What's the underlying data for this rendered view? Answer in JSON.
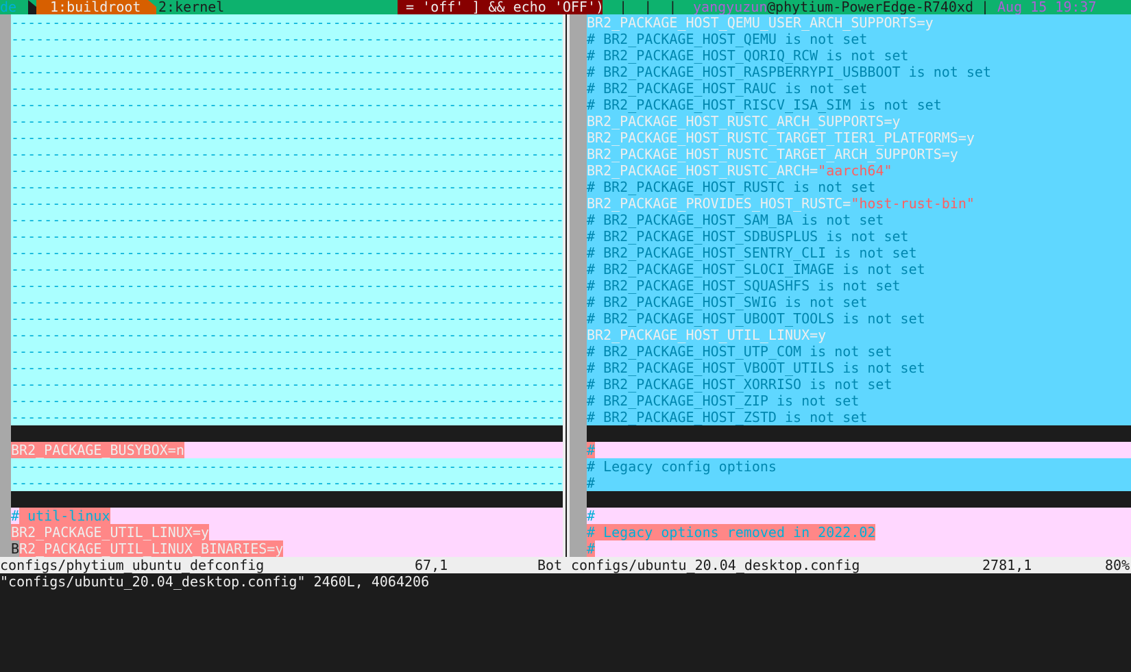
{
  "tmux": {
    "session": "de",
    "windows": [
      {
        "label": "1:buildroot",
        "active": true
      },
      {
        "label": "2:kernel",
        "active": false
      }
    ],
    "command_fragment": " = 'off' ] && echo 'OFF')",
    "separators": "  |  |  |  ",
    "user": "yangyuzun",
    "host": "@phytium-PowerEdge-R740xd",
    "divider": " | ",
    "datetime": "Aug 15 19:37"
  },
  "colors": {
    "tmux_bg": "#0db26e",
    "active_window": "#d75f00",
    "cmd_bg": "#870000",
    "accent_purple": "#af5fd7",
    "diff_change": "#5fd7ff",
    "diff_add": "#ffd7ff",
    "diff_text": "#ff8787",
    "filler": "#aaffff"
  },
  "filler_char": "-",
  "left": {
    "lines": [
      {
        "bg": "filler"
      },
      {
        "bg": "filler"
      },
      {
        "bg": "filler"
      },
      {
        "bg": "filler"
      },
      {
        "bg": "filler"
      },
      {
        "bg": "filler"
      },
      {
        "bg": "filler"
      },
      {
        "bg": "filler"
      },
      {
        "bg": "filler"
      },
      {
        "bg": "filler"
      },
      {
        "bg": "filler"
      },
      {
        "bg": "filler"
      },
      {
        "bg": "filler"
      },
      {
        "bg": "filler"
      },
      {
        "bg": "filler"
      },
      {
        "bg": "filler"
      },
      {
        "bg": "filler"
      },
      {
        "bg": "filler"
      },
      {
        "bg": "filler"
      },
      {
        "bg": "filler"
      },
      {
        "bg": "filler"
      },
      {
        "bg": "filler"
      },
      {
        "bg": "filler"
      },
      {
        "bg": "filler"
      },
      {
        "bg": "filler"
      },
      {
        "bg": "blank"
      },
      {
        "bg": "pink",
        "segs": [
          {
            "t": "BR2_PACKAGE_BUSYBOX=n",
            "c": "hl"
          }
        ]
      },
      {
        "bg": "filler"
      },
      {
        "bg": "filler"
      },
      {
        "bg": "blank"
      },
      {
        "bg": "pink",
        "segs": [
          {
            "t": "#",
            "c": "cmtl"
          },
          {
            "t": " util-linux",
            "c": "hlc"
          }
        ]
      },
      {
        "bg": "pink",
        "segs": [
          {
            "t": "BR2_PACKAGE_UTIL_LINUX=y",
            "c": "hl"
          }
        ]
      },
      {
        "bg": "pink",
        "segs": [
          {
            "t": "B",
            "c": "cur"
          },
          {
            "t": "R2_PACKAGE_UTIL_LINUX_BINARIES=y",
            "c": "hl"
          }
        ]
      }
    ]
  },
  "right": {
    "lines": [
      {
        "bg": "blue",
        "segs": [
          {
            "t": "BR2_PACKAGE_HOST_QEMU_USER_ARCH_SUPPORTS=y",
            "c": "set"
          }
        ]
      },
      {
        "bg": "blue",
        "segs": [
          {
            "t": "# BR2_PACKAGE_HOST_QEMU is not set",
            "c": "cmt"
          }
        ]
      },
      {
        "bg": "blue",
        "segs": [
          {
            "t": "# BR2_PACKAGE_HOST_QORIQ_RCW is not set",
            "c": "cmt"
          }
        ]
      },
      {
        "bg": "blue",
        "segs": [
          {
            "t": "# BR2_PACKAGE_HOST_RASPBERRYPI_USBBOOT is not set",
            "c": "cmt"
          }
        ]
      },
      {
        "bg": "blue",
        "segs": [
          {
            "t": "# BR2_PACKAGE_HOST_RAUC is not set",
            "c": "cmt"
          }
        ]
      },
      {
        "bg": "blue",
        "segs": [
          {
            "t": "# BR2_PACKAGE_HOST_RISCV_ISA_SIM is not set",
            "c": "cmt"
          }
        ]
      },
      {
        "bg": "blue",
        "segs": [
          {
            "t": "BR2_PACKAGE_HOST_RUSTC_ARCH_SUPPORTS=y",
            "c": "set"
          }
        ]
      },
      {
        "bg": "blue",
        "segs": [
          {
            "t": "BR2_PACKAGE_HOST_RUSTC_TARGET_TIER1_PLATFORMS=y",
            "c": "set"
          }
        ]
      },
      {
        "bg": "blue",
        "segs": [
          {
            "t": "BR2_PACKAGE_HOST_RUSTC_TARGET_ARCH_SUPPORTS=y",
            "c": "set"
          }
        ]
      },
      {
        "bg": "blue",
        "segs": [
          {
            "t": "BR2_PACKAGE_HOST_RUSTC_ARCH=",
            "c": "set"
          },
          {
            "t": "\"aarch64\"",
            "c": "str"
          }
        ]
      },
      {
        "bg": "blue",
        "segs": [
          {
            "t": "# BR2_PACKAGE_HOST_RUSTC is not set",
            "c": "cmt"
          }
        ]
      },
      {
        "bg": "blue",
        "segs": [
          {
            "t": "BR2_PACKAGE_PROVIDES_HOST_RUSTC=",
            "c": "set"
          },
          {
            "t": "\"host-rust-bin\"",
            "c": "str"
          }
        ]
      },
      {
        "bg": "blue",
        "segs": [
          {
            "t": "# BR2_PACKAGE_HOST_SAM_BA is not set",
            "c": "cmt"
          }
        ]
      },
      {
        "bg": "blue",
        "segs": [
          {
            "t": "# BR2_PACKAGE_HOST_SDBUSPLUS is not set",
            "c": "cmt"
          }
        ]
      },
      {
        "bg": "blue",
        "segs": [
          {
            "t": "# BR2_PACKAGE_HOST_SENTRY_CLI is not set",
            "c": "cmt"
          }
        ]
      },
      {
        "bg": "blue",
        "segs": [
          {
            "t": "# BR2_PACKAGE_HOST_SLOCI_IMAGE is not set",
            "c": "cmt"
          }
        ]
      },
      {
        "bg": "blue",
        "segs": [
          {
            "t": "# BR2_PACKAGE_HOST_SQUASHFS is not set",
            "c": "cmt"
          }
        ]
      },
      {
        "bg": "blue",
        "segs": [
          {
            "t": "# BR2_PACKAGE_HOST_SWIG is not set",
            "c": "cmt"
          }
        ]
      },
      {
        "bg": "blue",
        "segs": [
          {
            "t": "# BR2_PACKAGE_HOST_UBOOT_TOOLS is not set",
            "c": "cmt"
          }
        ]
      },
      {
        "bg": "blue",
        "segs": [
          {
            "t": "BR2_PACKAGE_HOST_UTIL_LINUX=y",
            "c": "set"
          }
        ]
      },
      {
        "bg": "blue",
        "segs": [
          {
            "t": "# BR2_PACKAGE_HOST_UTP_COM is not set",
            "c": "cmt"
          }
        ]
      },
      {
        "bg": "blue",
        "segs": [
          {
            "t": "# BR2_PACKAGE_HOST_VBOOT_UTILS is not set",
            "c": "cmt"
          }
        ]
      },
      {
        "bg": "blue",
        "segs": [
          {
            "t": "# BR2_PACKAGE_HOST_XORRISO is not set",
            "c": "cmt"
          }
        ]
      },
      {
        "bg": "blue",
        "segs": [
          {
            "t": "# BR2_PACKAGE_HOST_ZIP is not set",
            "c": "cmt"
          }
        ]
      },
      {
        "bg": "blue",
        "segs": [
          {
            "t": "# BR2_PACKAGE_HOST_ZSTD is not set",
            "c": "cmt"
          }
        ]
      },
      {
        "bg": "blank"
      },
      {
        "bg": "pink",
        "segs": [
          {
            "t": "#",
            "c": "hlc"
          }
        ]
      },
      {
        "bg": "blue",
        "segs": [
          {
            "t": "# Legacy config options",
            "c": "cmt"
          }
        ]
      },
      {
        "bg": "blue",
        "segs": [
          {
            "t": "#",
            "c": "cmt"
          }
        ]
      },
      {
        "bg": "blank"
      },
      {
        "bg": "pink",
        "segs": [
          {
            "t": "#",
            "c": "cmtl"
          }
        ]
      },
      {
        "bg": "pink",
        "segs": [
          {
            "t": "# Legacy options removed in 2022.02",
            "c": "hlc"
          }
        ]
      },
      {
        "bg": "pink",
        "segs": [
          {
            "t": "#",
            "c": "hlc"
          }
        ]
      }
    ]
  },
  "status": {
    "left_file": "configs/phytium_ubuntu_defconfig",
    "left_pos": "67,1",
    "left_scroll": "Bot",
    "right_file": "configs/ubuntu_20.04_desktop.config",
    "right_pos": "2781,1",
    "right_scroll": "80%"
  },
  "message": "\"configs/ubuntu_20.04_desktop.config\" 2460L, 4064206"
}
